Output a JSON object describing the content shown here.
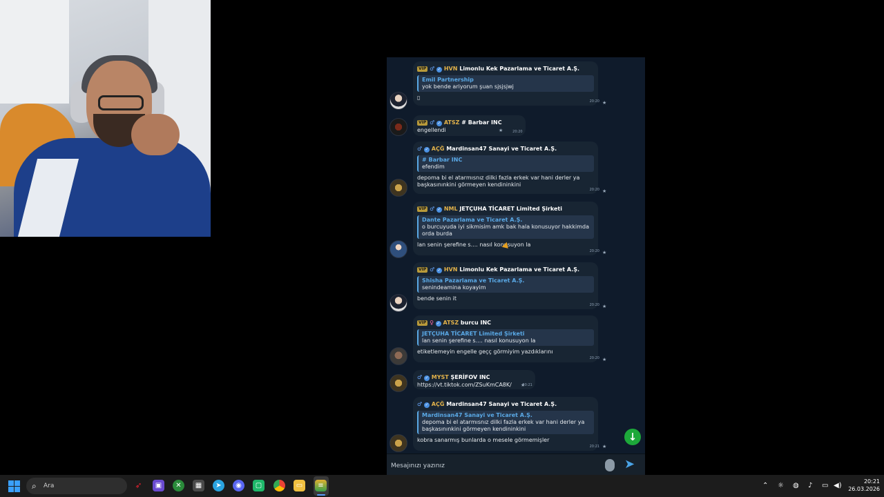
{
  "chat": {
    "messages": [
      {
        "sender_tag": "HVN",
        "sender": "Limonlu Kek Pazarlama ve Ticaret A.Ş.",
        "reply_name": "Emil Partnership",
        "reply_text": "yok bende ariyorum şuan sjsjsjwj",
        "text": "▯",
        "time": "20:20"
      },
      {
        "sender_tag": "ATSZ",
        "sender": "# Barbar INC",
        "text": "engellendi",
        "time": "20:20"
      },
      {
        "sender_tag": "AÇĞ",
        "sender": "Mardinsan47 Sanayi ve Ticaret A.Ş.",
        "reply_name": "# Barbar INC",
        "reply_text": "efendim",
        "text": "depoma bi el atarmısnız dilki fazla erkek var hani derler ya başkasınınkini görmeyen kendininkini",
        "time": "20:20"
      },
      {
        "sender_tag": "NML",
        "sender": "JETÇUHA TİCARET Limited Şirketi",
        "reply_name": "Dante Pazarlama ve Ticaret A.Ş.",
        "reply_text": "o burcuyuda iyi sikmisim amk bak hala konusuyor hakkimda orda burda",
        "text": "lan senin şerefine s.... nasıl konusuyon la",
        "time": "20:20"
      },
      {
        "sender_tag": "HVN",
        "sender": "Limonlu Kek Pazarlama ve Ticaret A.Ş.",
        "reply_name": "Shisha Pazarlama ve Ticaret A.Ş.",
        "reply_text": "senindeamina koyayim",
        "text": "bende senin it",
        "time": "20:20"
      },
      {
        "sender_tag": "ATSZ",
        "sender": "burcu INC",
        "reply_name": "JETÇUHA TİCARET Limited Şirketi",
        "reply_text": "lan senin şerefine s.... nasıl konusuyon la",
        "text": "etiketlemeyin engelle geçç görmiyim yazdıklarını",
        "time": "20:20"
      },
      {
        "sender_tag": "MYST",
        "sender": "ŞERİFOV INC",
        "text": "https://vt.tiktok.com/ZSuKmCA8K/",
        "time": "20:21"
      },
      {
        "sender_tag": "AÇĞ",
        "sender": "Mardinsan47 Sanayi ve Ticaret A.Ş.",
        "reply_name": "Mardinsan47 Sanayi ve Ticaret A.Ş.",
        "reply_text": "depoma bi el atarmısnız dilki fazla erkek var hani derler ya başkasınınkini görmeyen kendininkini",
        "text": "kobra sanarmış bunlarda o mesele görmemişler",
        "time": "20:21"
      }
    ],
    "composer_placeholder": "Mesajınızı yazınız"
  },
  "taskbar": {
    "search_placeholder": "Ara",
    "time": "20:21",
    "date": "26.03.2026"
  },
  "colors": {
    "accent": "#5aa9e6",
    "scroll_button": "#1da83a",
    "panel_bg": "#0f1b2b"
  }
}
